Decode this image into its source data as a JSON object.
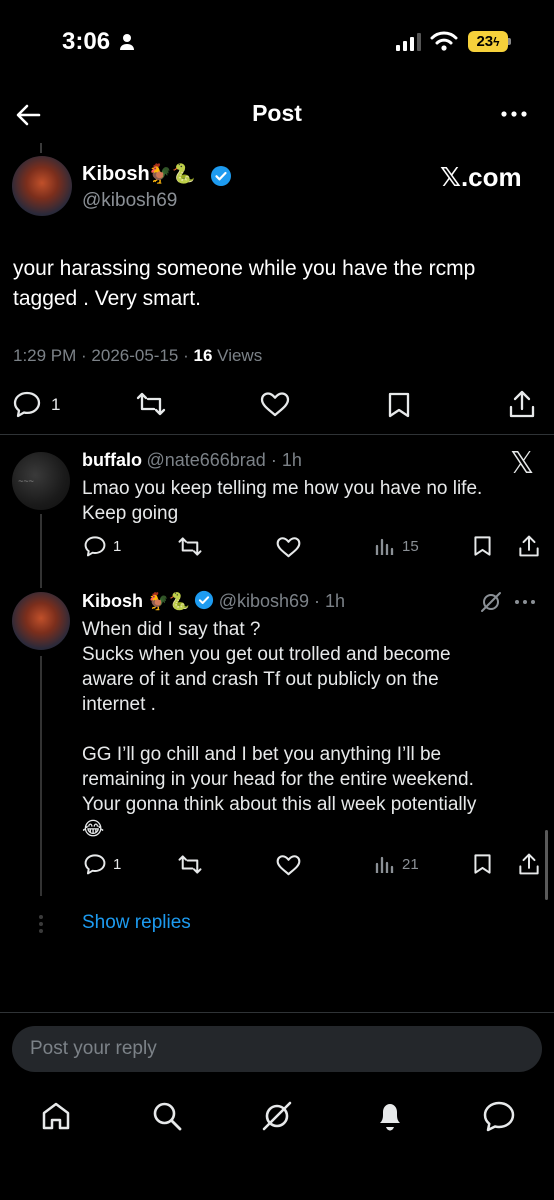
{
  "status_bar": {
    "time": "3:06",
    "battery": "23"
  },
  "header": {
    "title": "Post"
  },
  "post": {
    "author_name": "Kibosh",
    "author_emoji": "🐓🐍",
    "author_handle": "@kibosh69",
    "watermark": "𝕏.com",
    "text_line1": "your harassing someone while you have the rcmp",
    "text_line2": "tagged . Very smart.",
    "meta_time": "1:29 PM · 2026-05-15 ·",
    "views_count": "16",
    "views_label": "Views",
    "reply_count": "1"
  },
  "replies": [
    {
      "name": "buffalo",
      "handle_time": "@nate666brad · 1h",
      "lines": [
        "Lmao you keep telling me how you have no life.",
        "Keep going"
      ],
      "reply_count": "1",
      "views": "15"
    },
    {
      "name": "Kibosh",
      "emoji": "🐓🐍",
      "handle_time": "@kibosh69 · 1h",
      "lines": [
        "When did I say that ?",
        "Sucks when you get out trolled and become",
        "aware of it and crash Tf out publicly on the",
        "internet .",
        "",
        "GG I’ll go chill and I bet you anything I’ll be",
        "remaining in your head for the entire weekend.",
        "Your gonna think about this all week potentially",
        "😂"
      ],
      "reply_count": "1",
      "views": "21"
    }
  ],
  "show_replies": "Show replies",
  "reply_box": {
    "placeholder": "Post your reply"
  },
  "colors": {
    "background": "#000000",
    "accent": "#1d9bf0",
    "muted": "#7c8288"
  }
}
